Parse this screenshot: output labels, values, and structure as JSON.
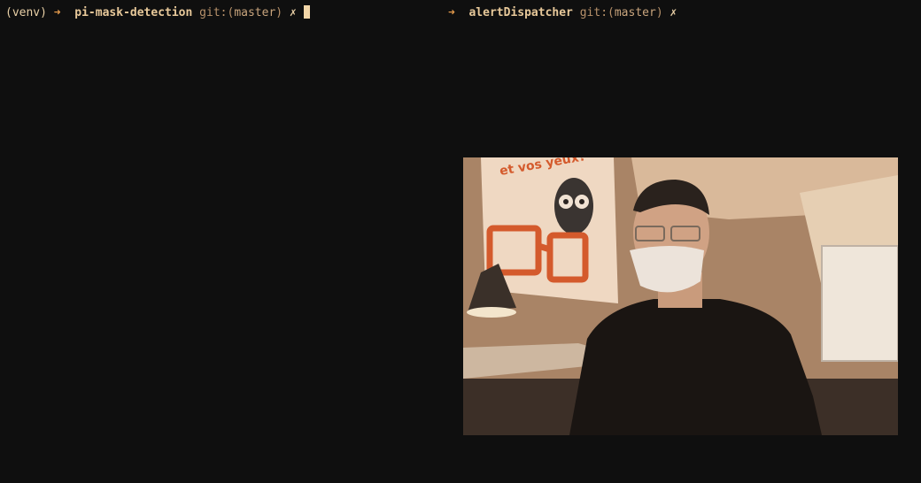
{
  "left_pane": {
    "venv": "(venv)",
    "arrow": "➜",
    "directory": "pi-mask-detection",
    "git_prefix": "git:(",
    "branch": "master",
    "git_suffix": ")",
    "dirty": "✗"
  },
  "right_pane": {
    "arrow": "➜",
    "directory": "alertDispatcher",
    "git_prefix": "git:(",
    "branch": "master",
    "git_suffix": ")",
    "dirty": "✗"
  },
  "webcam": {
    "poster_text": "et vos yeux?",
    "accent_color": "#d45a2c"
  },
  "colors": {
    "background": "#0f0f0f",
    "prompt_arrow": "#e39a4c",
    "text": "#e8cfa6"
  }
}
